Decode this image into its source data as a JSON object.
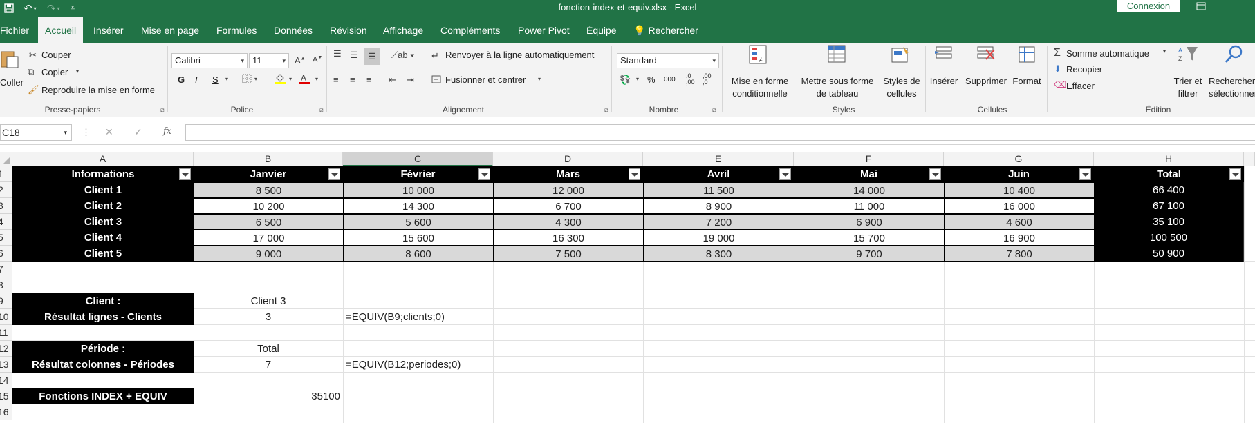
{
  "app": {
    "window_title": "fonction-index-et-equiv.xlsx  -  Excel",
    "sign_in": "Connexion"
  },
  "tabs": [
    {
      "label": "Fichier",
      "active": false
    },
    {
      "label": "Accueil",
      "active": true
    },
    {
      "label": "Insérer",
      "active": false
    },
    {
      "label": "Mise en page",
      "active": false
    },
    {
      "label": "Formules",
      "active": false
    },
    {
      "label": "Données",
      "active": false
    },
    {
      "label": "Révision",
      "active": false
    },
    {
      "label": "Affichage",
      "active": false
    },
    {
      "label": "Compléments",
      "active": false
    },
    {
      "label": "Power Pivot",
      "active": false
    },
    {
      "label": "Équipe",
      "active": false
    }
  ],
  "tell_me": "Rechercher",
  "ribbon": {
    "clipboard": {
      "paste": "Coller",
      "cut": "Couper",
      "copy": "Copier",
      "format_painter": "Reproduire la mise en forme",
      "label": "Presse-papiers"
    },
    "font": {
      "name": "Calibri",
      "size": "11",
      "bold": "G",
      "italic": "I",
      "underline": "S",
      "label": "Police"
    },
    "alignment": {
      "wrap": "Renvoyer à la ligne automatiquement",
      "merge": "Fusionner et centrer",
      "label": "Alignement"
    },
    "number": {
      "format": "Standard",
      "percent": "%",
      "thousands": "000",
      "inc_dec": ",0\n,00",
      "dec_dec": ",00\n,0",
      "label": "Nombre"
    },
    "styles": {
      "conditional_1": "Mise en forme",
      "conditional_2": "conditionnelle",
      "table_1": "Mettre sous forme",
      "table_2": "de tableau",
      "cell_1": "Styles de",
      "cell_2": "cellules",
      "label": "Styles"
    },
    "cells": {
      "insert": "Insérer",
      "delete": "Supprimer",
      "format": "Format",
      "label": "Cellules"
    },
    "editing": {
      "autosum": "Somme automatique",
      "fill": "Recopier",
      "clear": "Effacer",
      "sort_1": "Trier et",
      "sort_2": "filtrer",
      "find_1": "Rechercher",
      "find_2": "sélectionner",
      "label": "Édition"
    }
  },
  "formula_bar": {
    "name_box": "C18",
    "formula": ""
  },
  "sheet": {
    "columns": [
      "A",
      "B",
      "C",
      "D",
      "E",
      "F",
      "G",
      "H"
    ],
    "rows": [
      "1",
      "2",
      "3",
      "4",
      "5",
      "6",
      "7",
      "8",
      "9",
      "10",
      "11",
      "12",
      "13",
      "14",
      "15",
      "16"
    ],
    "table": {
      "headers": [
        "Informations",
        "Janvier",
        "Février",
        "Mars",
        "Avril",
        "Mai",
        "Juin",
        "Total"
      ],
      "rows": [
        {
          "label": "Client 1",
          "values": [
            "8 500",
            "10 000",
            "12 000",
            "11 500",
            "14 000",
            "10 400"
          ],
          "total": "66 400"
        },
        {
          "label": "Client 2",
          "values": [
            "10 200",
            "14 300",
            "6 700",
            "8 900",
            "11 000",
            "16 000"
          ],
          "total": "67 100"
        },
        {
          "label": "Client 3",
          "values": [
            "6 500",
            "5 600",
            "4 300",
            "7 200",
            "6 900",
            "4 600"
          ],
          "total": "35 100"
        },
        {
          "label": "Client 4",
          "values": [
            "17 000",
            "15 600",
            "16 300",
            "19 000",
            "15 700",
            "16 900"
          ],
          "total": "100 500"
        },
        {
          "label": "Client 5",
          "values": [
            "9 000",
            "8 600",
            "7 500",
            "8 300",
            "9 700",
            "7 800"
          ],
          "total": "50 900"
        }
      ]
    },
    "lookup": {
      "client_label": "Client :",
      "client_value": "Client 3",
      "row_label": "Résultat lignes - Clients",
      "row_value": "3",
      "row_formula": "=EQUIV(B9;clients;0)",
      "period_label": "Période :",
      "period_value": "Total",
      "col_label": "Résultat colonnes - Périodes",
      "col_value": "7",
      "col_formula": "=EQUIV(B12;periodes;0)",
      "index_label": "Fonctions INDEX + EQUIV",
      "index_value": "35100"
    }
  },
  "colors": {
    "excel_green": "#217346",
    "ribbon_bg": "#f3f3f3",
    "band_gray": "#d9d9d9",
    "header_black": "#000000"
  }
}
